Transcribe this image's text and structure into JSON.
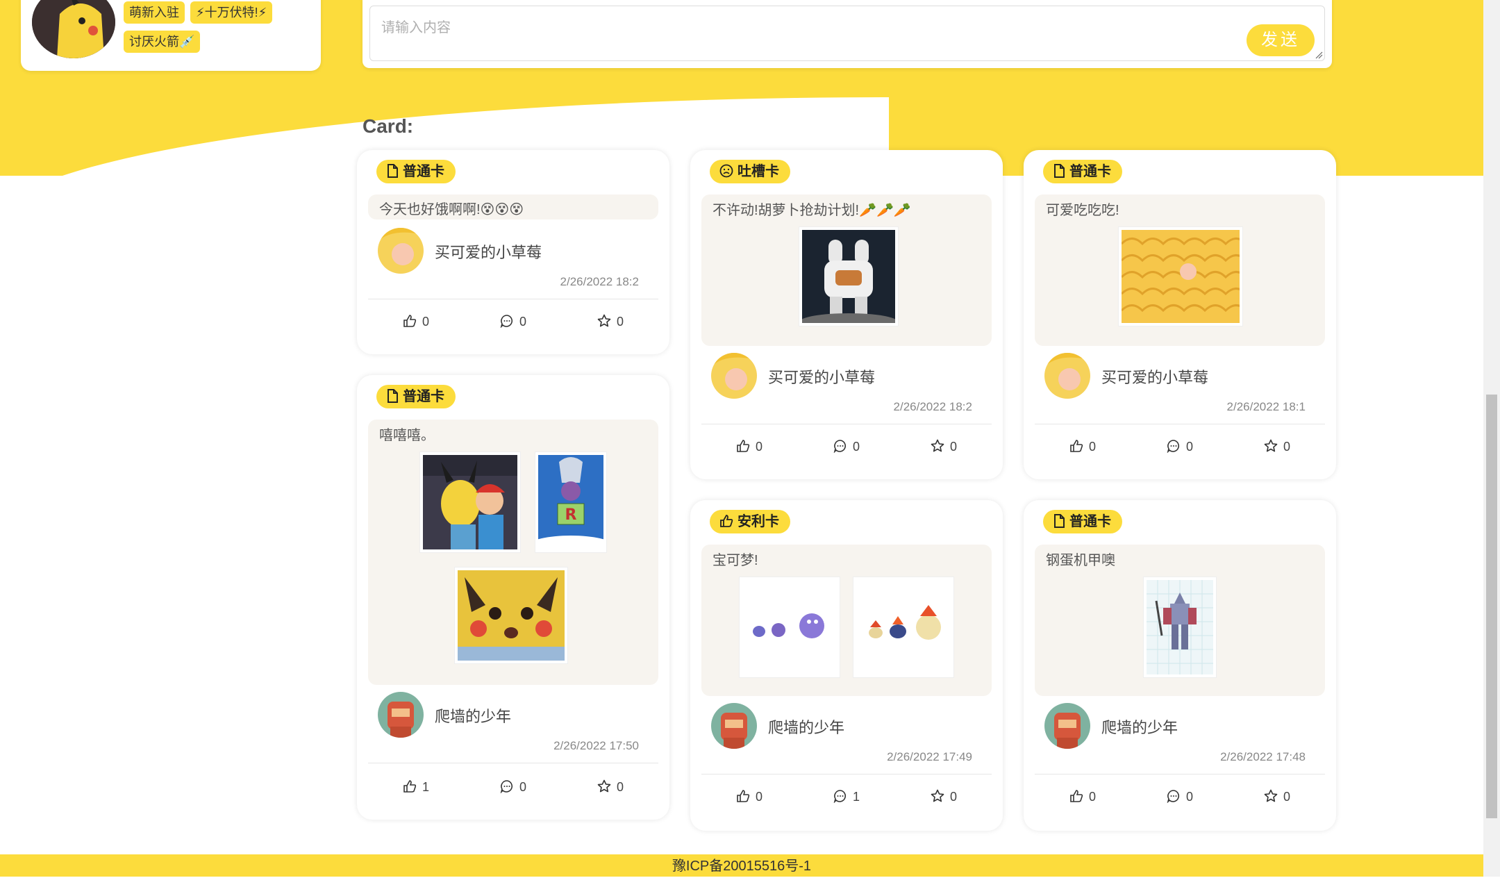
{
  "profile": {
    "tags": [
      "萌新入驻",
      "⚡十万伏特!⚡",
      "讨厌火箭💉"
    ]
  },
  "composer": {
    "placeholder": "请输入内容",
    "send_label": "发送"
  },
  "section_title": "Card:",
  "cards": [
    {
      "type": "普通卡",
      "type_icon": "document-icon",
      "text": "今天也好饿啊啊!😵😵😵",
      "author": "买可爱的小草莓",
      "time": "2/26/2022 18:2",
      "likes": "0",
      "comments": "0",
      "stars": "0"
    },
    {
      "type": "普通卡",
      "type_icon": "document-icon",
      "text": "嘻嘻嘻。",
      "author": "爬墙的少年",
      "time": "2/26/2022 17:50",
      "likes": "1",
      "comments": "0",
      "stars": "0"
    },
    {
      "type": "吐槽卡",
      "type_icon": "frown-face-icon",
      "text": "不许动!胡萝卜抢劫计划!🥕🥕🥕",
      "author": "买可爱的小草莓",
      "time": "2/26/2022 18:2",
      "likes": "0",
      "comments": "0",
      "stars": "0"
    },
    {
      "type": "安利卡",
      "type_icon": "thumbs-up-icon",
      "text": "宝可梦!",
      "author": "爬墙的少年",
      "time": "2/26/2022 17:49",
      "likes": "0",
      "comments": "1",
      "stars": "0"
    },
    {
      "type": "普通卡",
      "type_icon": "document-icon",
      "text": "可爱吃吃吃!",
      "author": "买可爱的小草莓",
      "time": "2/26/2022 18:1",
      "likes": "0",
      "comments": "0",
      "stars": "0"
    },
    {
      "type": "普通卡",
      "type_icon": "document-icon",
      "text": "钢蛋机甲噢",
      "author": "爬墙的少年",
      "time": "2/26/2022 17:48",
      "likes": "0",
      "comments": "0",
      "stars": "0"
    }
  ],
  "footer": {
    "icp": "豫ICP备20015516号-1"
  },
  "colors": {
    "accent": "#fcdc3c",
    "content_bg": "#f7f4ef"
  }
}
